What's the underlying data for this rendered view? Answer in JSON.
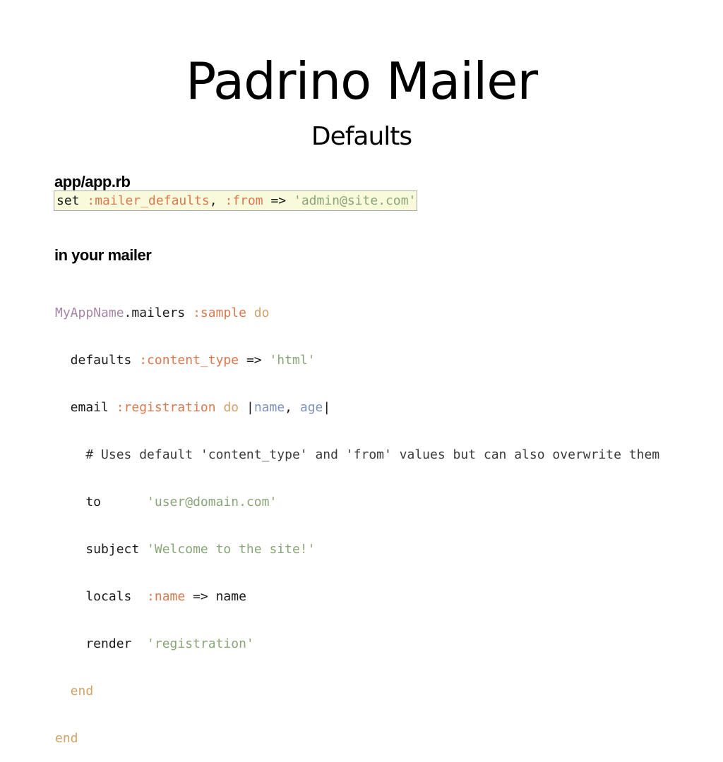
{
  "slide": {
    "title": "Padrino Mailer",
    "subtitle": "Defaults"
  },
  "section_app": {
    "label": "app/app.rb",
    "code": {
      "t1": "set ",
      "t2": ":mailer_defaults",
      "t3": ", ",
      "t4": ":from",
      "t5": " => ",
      "t6": "'admin@site.com'"
    }
  },
  "section_mailer": {
    "label": "in your mailer",
    "lines": {
      "l1": {
        "a": "MyAppName",
        "b": ".mailers ",
        "c": ":sample",
        "d": " ",
        "e": "do"
      },
      "l2": {
        "a": "  defaults ",
        "b": ":content_type",
        "c": " => ",
        "d": "'html'"
      },
      "l3": {
        "a": "  email ",
        "b": ":registration",
        "c": " ",
        "d": "do",
        "e": " |",
        "f": "name",
        "g": ", ",
        "h": "age",
        "i": "|"
      },
      "l4": {
        "a": "    # Uses default 'content_type' and 'from' values but can also overwrite them"
      },
      "l5": {
        "a": "    to      ",
        "b": "'user@domain.com'"
      },
      "l6": {
        "a": "    subject ",
        "b": "'Welcome to the site!'"
      },
      "l7": {
        "a": "    locals  ",
        "b": ":name",
        "c": " => name"
      },
      "l8": {
        "a": "    render  ",
        "b": "'registration'"
      },
      "l9": {
        "a": "  end"
      },
      "l10": {
        "a": "end"
      }
    }
  },
  "colors": {
    "symbol": "#d9794f",
    "string": "#8aa577",
    "keyword": "#d0a268",
    "constant": "#a385a5",
    "block_var": "#7f94b8",
    "codebox_bg": "#f9f9dc"
  }
}
